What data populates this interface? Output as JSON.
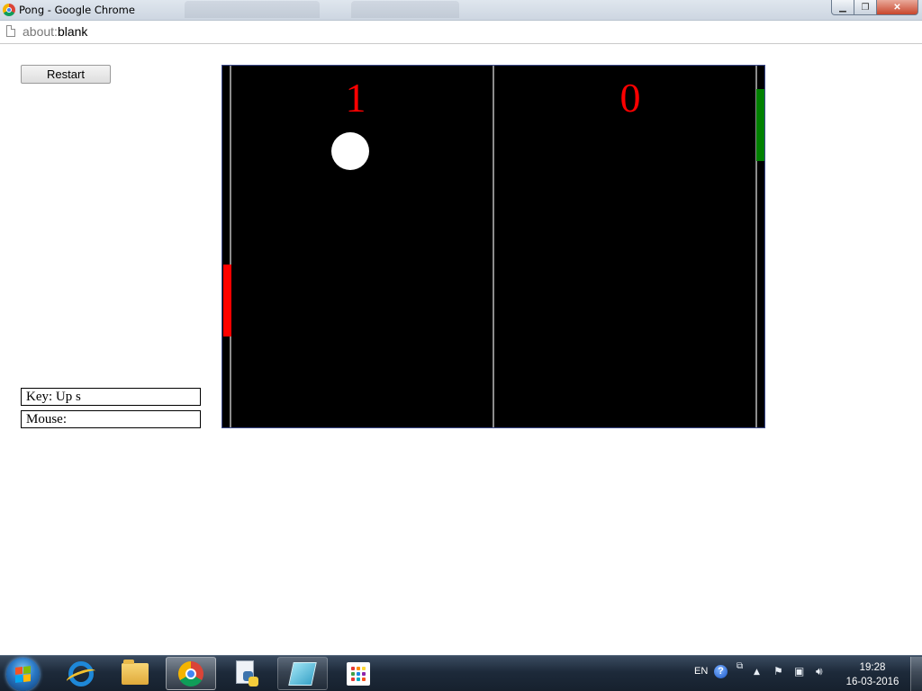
{
  "window": {
    "title": "Pong - Google Chrome",
    "controls": {
      "minimize": "▁",
      "maximize": "❐",
      "close": "✕"
    }
  },
  "address_bar": {
    "scheme": "about:",
    "host": "blank"
  },
  "page": {
    "restart_label": "Restart",
    "key_status": "Key: Up s",
    "mouse_status": "Mouse: "
  },
  "game": {
    "score_left": "1",
    "score_right": "0",
    "colors": {
      "background": "#000000",
      "score": "#ff0000",
      "ball": "#ffffff",
      "left_paddle": "#ff0000",
      "right_paddle": "#008000",
      "lines": "#8c8c8c"
    }
  },
  "taskbar": {
    "pinned": [
      "start-orb",
      "internet-explorer-icon",
      "file-explorer-icon",
      "chrome-icon",
      "python-icon",
      "notepad-icon",
      "apps-icon"
    ],
    "tray": {
      "language": "EN",
      "help": "?",
      "time": "19:28",
      "date": "16-03-2016"
    }
  }
}
